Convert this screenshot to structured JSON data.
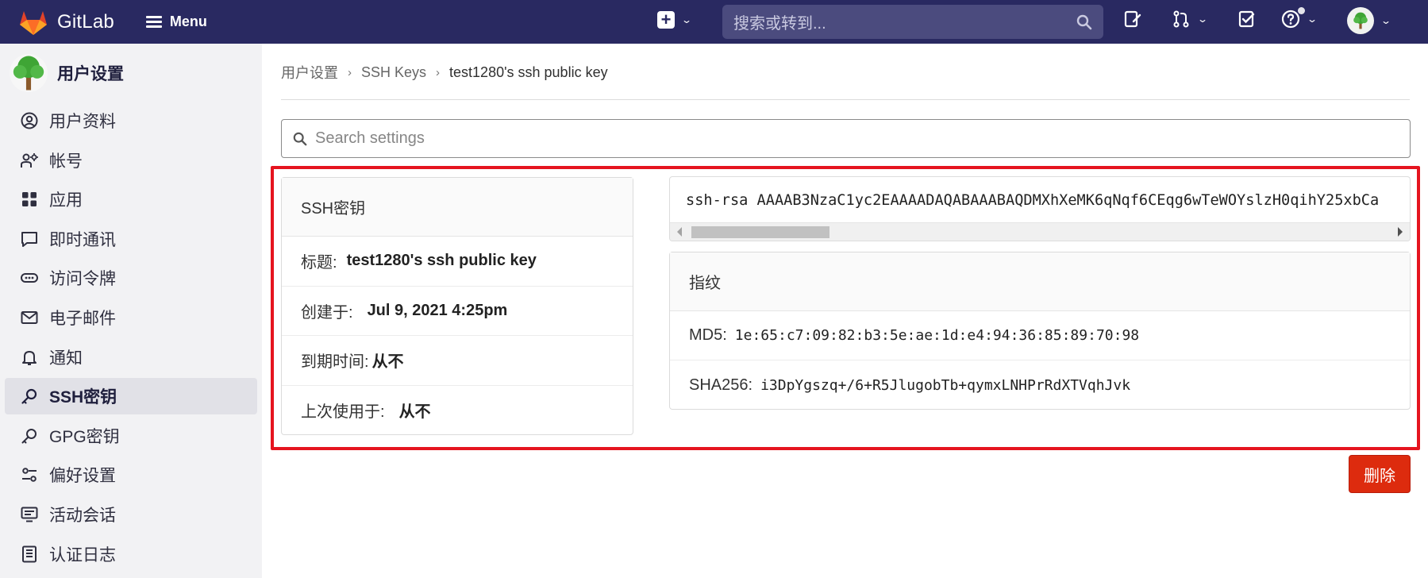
{
  "topbar": {
    "brand": "GitLab",
    "menu_label": "Menu",
    "search_placeholder": "搜索或转到...",
    "bg_color": "#292961"
  },
  "sidebar": {
    "title": "用户设置",
    "items": [
      {
        "label": "用户资料",
        "icon": "profile-icon",
        "active": false
      },
      {
        "label": "帐号",
        "icon": "account-icon",
        "active": false
      },
      {
        "label": "应用",
        "icon": "applications-icon",
        "active": false
      },
      {
        "label": "即时通讯",
        "icon": "chat-icon",
        "active": false
      },
      {
        "label": "访问令牌",
        "icon": "token-icon",
        "active": false
      },
      {
        "label": "电子邮件",
        "icon": "mail-icon",
        "active": false
      },
      {
        "label": "通知",
        "icon": "notifications-icon",
        "active": false
      },
      {
        "label": "SSH密钥",
        "icon": "key-icon",
        "active": true
      },
      {
        "label": "GPG密钥",
        "icon": "key-icon",
        "active": false
      },
      {
        "label": "偏好设置",
        "icon": "preferences-icon",
        "active": false
      },
      {
        "label": "活动会话",
        "icon": "sessions-icon",
        "active": false
      },
      {
        "label": "认证日志",
        "icon": "log-icon",
        "active": false
      }
    ]
  },
  "breadcrumb": [
    "用户设置",
    "SSH Keys",
    "test1280's ssh public key"
  ],
  "settings_search": {
    "placeholder": "Search settings"
  },
  "key_card": {
    "header": "SSH密钥",
    "title_label": "标题:",
    "title_value": "test1280's ssh public key",
    "created_label": "创建于:",
    "created_value": "Jul 9, 2021 4:25pm",
    "expires_label": "到期时间:",
    "expires_value": "从不",
    "last_used_label": "上次使用于:",
    "last_used_value": "从不"
  },
  "public_key": "ssh-rsa AAAAB3NzaC1yc2EAAAADAQABAAABAQDMXhXeMK6qNqf6CEqg6wTeWOYslzH0qihY25xbCa",
  "fingerprints": {
    "header": "指纹",
    "md5_label": "MD5:",
    "md5_value": "1e:65:c7:09:82:b3:5e:ae:1d:e4:94:36:85:89:70:98",
    "sha256_label": "SHA256:",
    "sha256_value": "i3DpYgszq+/6+R5JlugobTb+qymxLNHPrRdXTVqhJvk"
  },
  "delete_button": "删除",
  "colors": {
    "danger": "#dd2b0e",
    "highlight_frame": "#e5141f"
  }
}
